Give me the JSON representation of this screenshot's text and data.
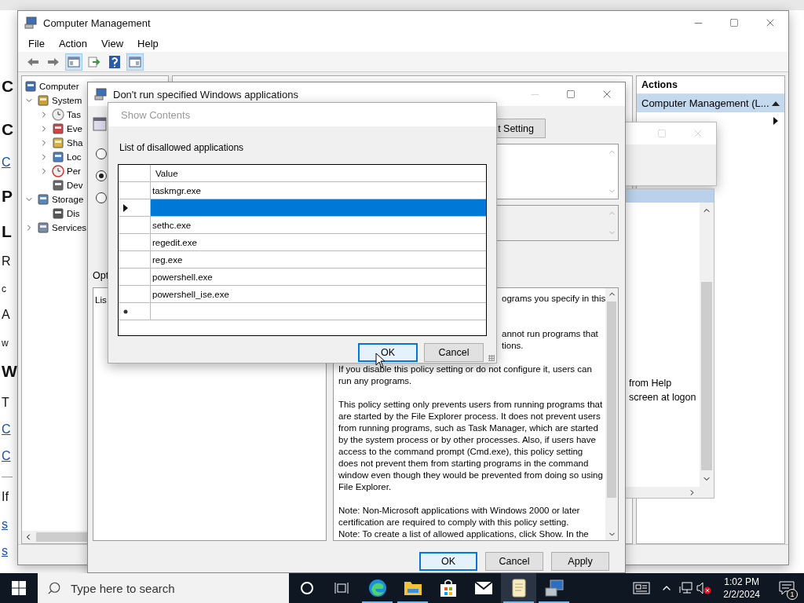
{
  "background_page": {
    "lines": [
      {
        "kind": "heading",
        "text": "C"
      },
      {
        "kind": "heading",
        "text": "C"
      },
      {
        "kind": "link",
        "text": "C"
      },
      {
        "kind": "heading",
        "text": "P"
      },
      {
        "kind": "heading",
        "text": "L"
      },
      {
        "kind": "text",
        "text": "R"
      },
      {
        "kind": "small",
        "text": "c"
      },
      {
        "kind": "text",
        "text": "A"
      },
      {
        "kind": "small",
        "text": "w"
      },
      {
        "kind": "heading",
        "text": "W"
      },
      {
        "kind": "text",
        "text": "T"
      },
      {
        "kind": "link",
        "text": "C"
      },
      {
        "kind": "link",
        "text": "C"
      },
      {
        "kind": "text",
        "text": "If"
      },
      {
        "kind": "link",
        "text": "s"
      },
      {
        "kind": "link",
        "text": "s"
      }
    ]
  },
  "computer_management": {
    "title": "Computer Management",
    "menu": [
      "File",
      "Action",
      "View",
      "Help"
    ],
    "toolbar": [
      {
        "kind": "back",
        "selected": false
      },
      {
        "kind": "forward",
        "selected": false
      },
      {
        "kind": "tree",
        "selected": true
      },
      {
        "kind": "export",
        "selected": false
      },
      {
        "kind": "help",
        "selected": false
      },
      {
        "kind": "pane",
        "selected": true
      }
    ],
    "tree": [
      {
        "label": "Computer",
        "kind": "computer",
        "children": [
          {
            "label": "System",
            "kind": "tools",
            "expanded": true,
            "children": [
              {
                "label": "Tas",
                "kind": "clock",
                "expanded": false
              },
              {
                "label": "Eve",
                "kind": "log",
                "expanded": false
              },
              {
                "label": "Sha",
                "kind": "share",
                "expanded": false
              },
              {
                "label": "Loc",
                "kind": "users",
                "expanded": false
              },
              {
                "label": "Per",
                "kind": "gauge",
                "expanded": false
              },
              {
                "label": "Dev",
                "kind": "device"
              }
            ]
          },
          {
            "label": "Storage",
            "kind": "storage",
            "expanded": true,
            "children": [
              {
                "label": "Dis",
                "kind": "disk"
              }
            ]
          },
          {
            "label": "Services",
            "kind": "services",
            "expanded": false
          }
        ]
      }
    ],
    "actions": {
      "title": "Actions",
      "section": {
        "label": "Computer Management (L...",
        "expanded": true
      }
    }
  },
  "back_window": {
    "lines": [
      "from Help",
      "screen at logon"
    ]
  },
  "policy_dialog": {
    "title": "Don't run specified Windows applications",
    "radios": [
      {
        "selected": false
      },
      {
        "selected": true
      },
      {
        "selected": false
      }
    ],
    "setting_button": "t Setting",
    "options_label": "Opt",
    "options_heading": "Lis",
    "help": [
      {
        "kind": "fragment",
        "text": "ograms you specify in this"
      },
      {
        "kind": "gap"
      },
      {
        "kind": "gap"
      },
      {
        "kind": "fragment",
        "text": "annot run programs that"
      },
      {
        "kind": "fragment",
        "text": "tions."
      },
      {
        "kind": "gap"
      },
      {
        "kind": "paragraph",
        "text": "If you disable this policy setting or do not configure it, users can run any programs."
      },
      {
        "kind": "gap"
      },
      {
        "kind": "paragraph",
        "text": "This policy setting only prevents users from running programs that are started by the File Explorer process. It does not prevent users from running programs, such as Task Manager, which are started by the system process or by other processes.  Also, if users have access to the command prompt (Cmd.exe), this policy setting does not prevent them from starting programs in the command window even though they would be prevented from doing so using File Explorer."
      },
      {
        "kind": "gap"
      },
      {
        "kind": "paragraph",
        "text": "Note: Non-Microsoft applications with Windows 2000 or later certification are required to comply with this policy setting."
      },
      {
        "kind": "paragraph",
        "text": "Note: To create a list of allowed applications, click Show.  In the"
      }
    ],
    "buttons": [
      {
        "label": "OK",
        "focused": true
      },
      {
        "label": "Cancel",
        "focused": false
      },
      {
        "label": "Apply",
        "focused": false
      }
    ]
  },
  "show_contents": {
    "title": "Show Contents",
    "label": "List of disallowed applications",
    "column": "Value",
    "rows": [
      {
        "value": "taskmgr.exe",
        "selected": false
      },
      {
        "selected": true
      },
      {
        "value": "sethc.exe",
        "selected": false
      },
      {
        "value": "regedit.exe",
        "selected": false
      },
      {
        "value": "reg.exe",
        "selected": false
      },
      {
        "value": "powershell.exe",
        "selected": false
      },
      {
        "value": "powershell_ise.exe",
        "selected": false
      },
      {
        "kind": "new",
        "selected": false
      }
    ],
    "buttons": [
      {
        "label": "OK",
        "focused": true
      },
      {
        "label": "Cancel",
        "focused": false
      }
    ]
  },
  "taskbar": {
    "search_placeholder": "Type here to search",
    "apps": [
      {
        "kind": "edge",
        "running": true,
        "active": false
      },
      {
        "kind": "explorer",
        "running": true,
        "active": false
      },
      {
        "kind": "store",
        "running": false,
        "active": false
      },
      {
        "kind": "mail",
        "running": false,
        "active": false
      },
      {
        "kind": "notepad",
        "running": true,
        "active": true
      },
      {
        "kind": "computer",
        "running": true,
        "active": false
      }
    ],
    "time": "1:02 PM",
    "date": "2/2/2024",
    "notifications": "1"
  }
}
